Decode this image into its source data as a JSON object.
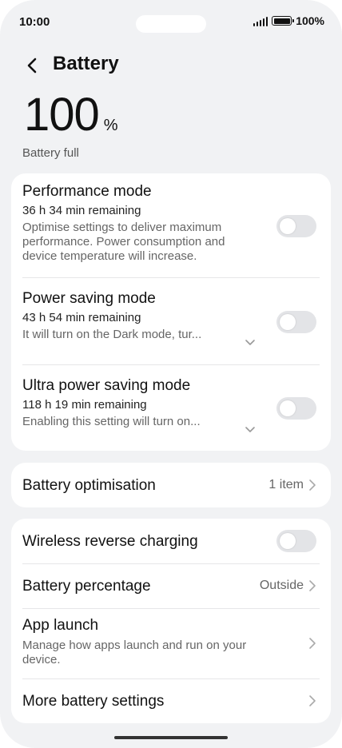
{
  "status_bar": {
    "time": "10:00",
    "battery_percent": "100%",
    "icons": [
      "signal-icon",
      "battery-icon"
    ]
  },
  "header": {
    "title": "Battery",
    "back_icon": "back-arrow-icon"
  },
  "battery": {
    "value": "100",
    "unit": "%",
    "status": "Battery full"
  },
  "modes": [
    {
      "title": "Performance mode",
      "remaining": "36 h 34 min remaining",
      "description": "Optimise settings to deliver maximum performance. Power consumption and device temperature will increase.",
      "enabled": false
    },
    {
      "title": "Power saving mode",
      "remaining": "43 h 54 min remaining",
      "description": "It will turn on the Dark mode, tur...",
      "enabled": false
    },
    {
      "title": "Ultra power saving mode",
      "remaining": "118 h 19 min remaining",
      "description": "Enabling this setting will turn on...",
      "enabled": false
    }
  ],
  "optimisation": {
    "title": "Battery optimisation",
    "value": "1 item"
  },
  "settings": {
    "wireless": {
      "title": "Wireless reverse charging",
      "enabled": false
    },
    "percentage": {
      "title": "Battery percentage",
      "value": "Outside"
    },
    "app_launch": {
      "title": "App launch",
      "description": "Manage how apps launch and run on your device."
    },
    "more": {
      "title": "More battery settings"
    }
  },
  "colors": {
    "background": "#f1f2f4",
    "card": "#ffffff",
    "toggle_off": "#e3e4e7",
    "secondary_text": "#666666"
  }
}
